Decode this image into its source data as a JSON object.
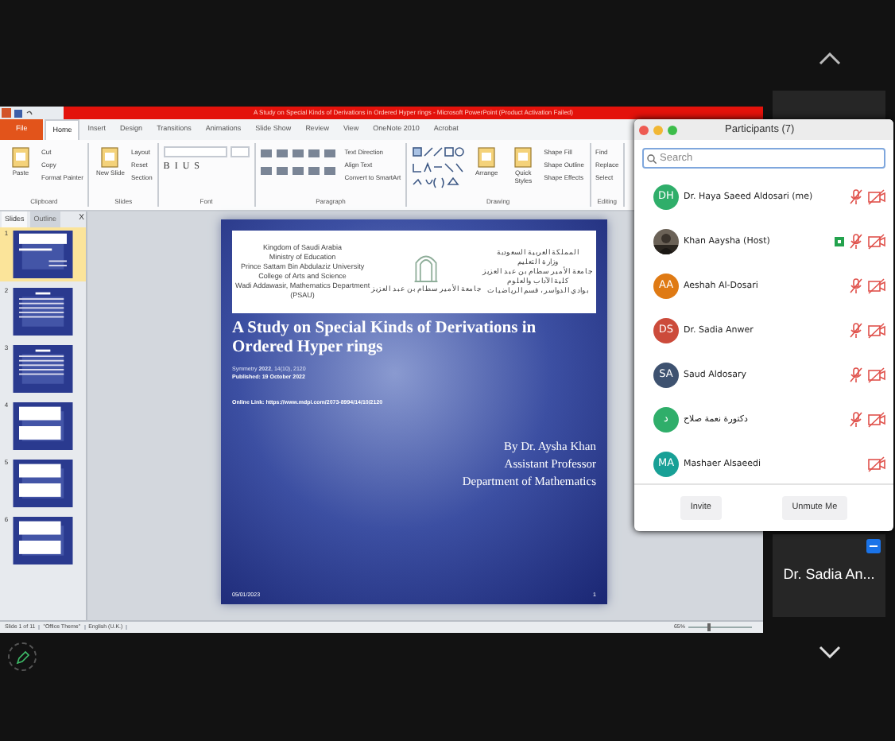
{
  "powerpoint": {
    "title": "A Study on Special Kinds of Derivations in Ordered Hyper rings - Microsoft PowerPoint (Product Activation Failed)",
    "tabs": [
      {
        "label": "File",
        "kind": "file",
        "selected": false
      },
      {
        "label": "Home",
        "kind": "tab",
        "selected": true
      },
      {
        "label": "Insert",
        "kind": "tab",
        "selected": false
      },
      {
        "label": "Design",
        "kind": "tab",
        "selected": false
      },
      {
        "label": "Transitions",
        "kind": "tab",
        "selected": false
      },
      {
        "label": "Animations",
        "kind": "tab",
        "selected": false
      },
      {
        "label": "Slide Show",
        "kind": "tab",
        "selected": false
      },
      {
        "label": "Review",
        "kind": "tab",
        "selected": false
      },
      {
        "label": "View",
        "kind": "tab",
        "selected": false
      },
      {
        "label": "OneNote 2010",
        "kind": "tab",
        "selected": false
      },
      {
        "label": "Acrobat",
        "kind": "tab",
        "selected": false
      }
    ],
    "ribbon": [
      {
        "label": "Clipboard",
        "kind": "plain",
        "large": [
          "Paste"
        ],
        "small": [
          "Cut",
          "Copy",
          "Format Painter"
        ]
      },
      {
        "label": "Slides",
        "kind": "plain",
        "large": [
          "New Slide"
        ],
        "small": [
          "Layout",
          "Reset",
          "Section"
        ]
      },
      {
        "label": "Font",
        "kind": "font",
        "small": [
          "B",
          "I",
          "U",
          "S"
        ]
      },
      {
        "label": "Paragraph",
        "kind": "paragraph",
        "small": [
          "Text Direction",
          "Align Text",
          "Convert to SmartArt"
        ]
      },
      {
        "label": "Drawing",
        "kind": "drawing",
        "large": [
          "Arrange",
          "Quick Styles"
        ],
        "small": [
          "Shape Fill",
          "Shape Outline",
          "Shape Effects"
        ]
      },
      {
        "label": "Editing",
        "kind": "plain",
        "small": [
          "Find",
          "Replace",
          "Select"
        ]
      }
    ],
    "slides_pane": {
      "tabs": [
        {
          "label": "Slides",
          "selected": true
        },
        {
          "label": "Outline",
          "selected": false
        }
      ],
      "close": "X",
      "thumbnails": [
        {
          "number": "1",
          "kind": "title",
          "selected": true
        },
        {
          "number": "2",
          "kind": "text",
          "selected": false
        },
        {
          "number": "3",
          "kind": "text",
          "selected": false
        },
        {
          "number": "4",
          "kind": "boxes",
          "selected": false
        },
        {
          "number": "5",
          "kind": "boxes",
          "selected": false
        },
        {
          "number": "6",
          "kind": "boxes",
          "selected": false
        }
      ]
    },
    "slide": {
      "header_left": [
        "Kingdom of Saudi Arabia",
        "Ministry of Education",
        "Prince Sattam Bin Abdulaziz University",
        "College of Arts and Science",
        "Wadi Addawasir, Mathematics Department",
        "(PSAU)"
      ],
      "header_right": [
        "المملكة العربية السعودية",
        "وزارة التعليم",
        "جامعة الأمير سطام بن عبد العزيز",
        "كلية الآداب والعلوم",
        "بوادي الدواسر، قسم الرياضيات"
      ],
      "logo_caption": "جامعة الأمير سطام بن عبد العزيز",
      "title": "A Study on Special Kinds of Derivations in Ordered Hyper rings",
      "citation": "Symmetry **2022**, 14(10), 2120",
      "published": "Published: 19 October 2022",
      "link": "Online Link: https://www.mdpi.com/2073-8994/14/10/2120",
      "author_lines": [
        "By Dr. Aysha Khan",
        "Assistant Professor",
        "Department of Mathematics"
      ],
      "date": "05/01/2023",
      "number": "1"
    },
    "status_bar": {
      "items": [
        "Slide 1 of 11",
        "\"Office Theme\"",
        "English (U.K.)"
      ],
      "zoom": "65%",
      "zoom_slider": {
        "level": 0.3
      }
    }
  },
  "participants": {
    "title": "Participants (7)",
    "search": {
      "placeholder": "Search"
    },
    "people": [
      {
        "name": "Dr. Haya Saeed Aldosari (me)",
        "kind": "initials",
        "initials": "DH",
        "color": "#2fae6a",
        "sharing": false,
        "mic_muted": true,
        "video_off": true
      },
      {
        "name": "Khan Aaysha (Host)",
        "kind": "picture",
        "sharing": true,
        "mic_muted": true,
        "video_off": true
      },
      {
        "name": "Aeshah Al-Dosari",
        "kind": "initials",
        "initials": "AA",
        "color": "#df7a14",
        "sharing": false,
        "mic_muted": true,
        "video_off": true
      },
      {
        "name": "Dr. Sadia Anwer",
        "kind": "initials",
        "initials": "DS",
        "color": "#cc4b3b",
        "sharing": false,
        "mic_muted": true,
        "video_off": true
      },
      {
        "name": "Saud Aldosary",
        "kind": "initials",
        "initials": "SA",
        "color": "#3e5270",
        "sharing": false,
        "mic_muted": true,
        "video_off": true
      },
      {
        "name": "دكتورة نعمة صلاح",
        "kind": "initials",
        "initials": "د",
        "color": "#2fae6a",
        "sharing": false,
        "mic_muted": true,
        "video_off": true
      },
      {
        "name": "Mashaer Alsaeedi",
        "kind": "initials",
        "initials": "MA",
        "color": "#18a096",
        "sharing": false,
        "mic_muted": false,
        "video_off": true
      }
    ],
    "buttons": [
      "Invite",
      "Unmute Me"
    ]
  },
  "video_tiles": [
    {
      "name": "Dr. Sadia An..."
    }
  ]
}
